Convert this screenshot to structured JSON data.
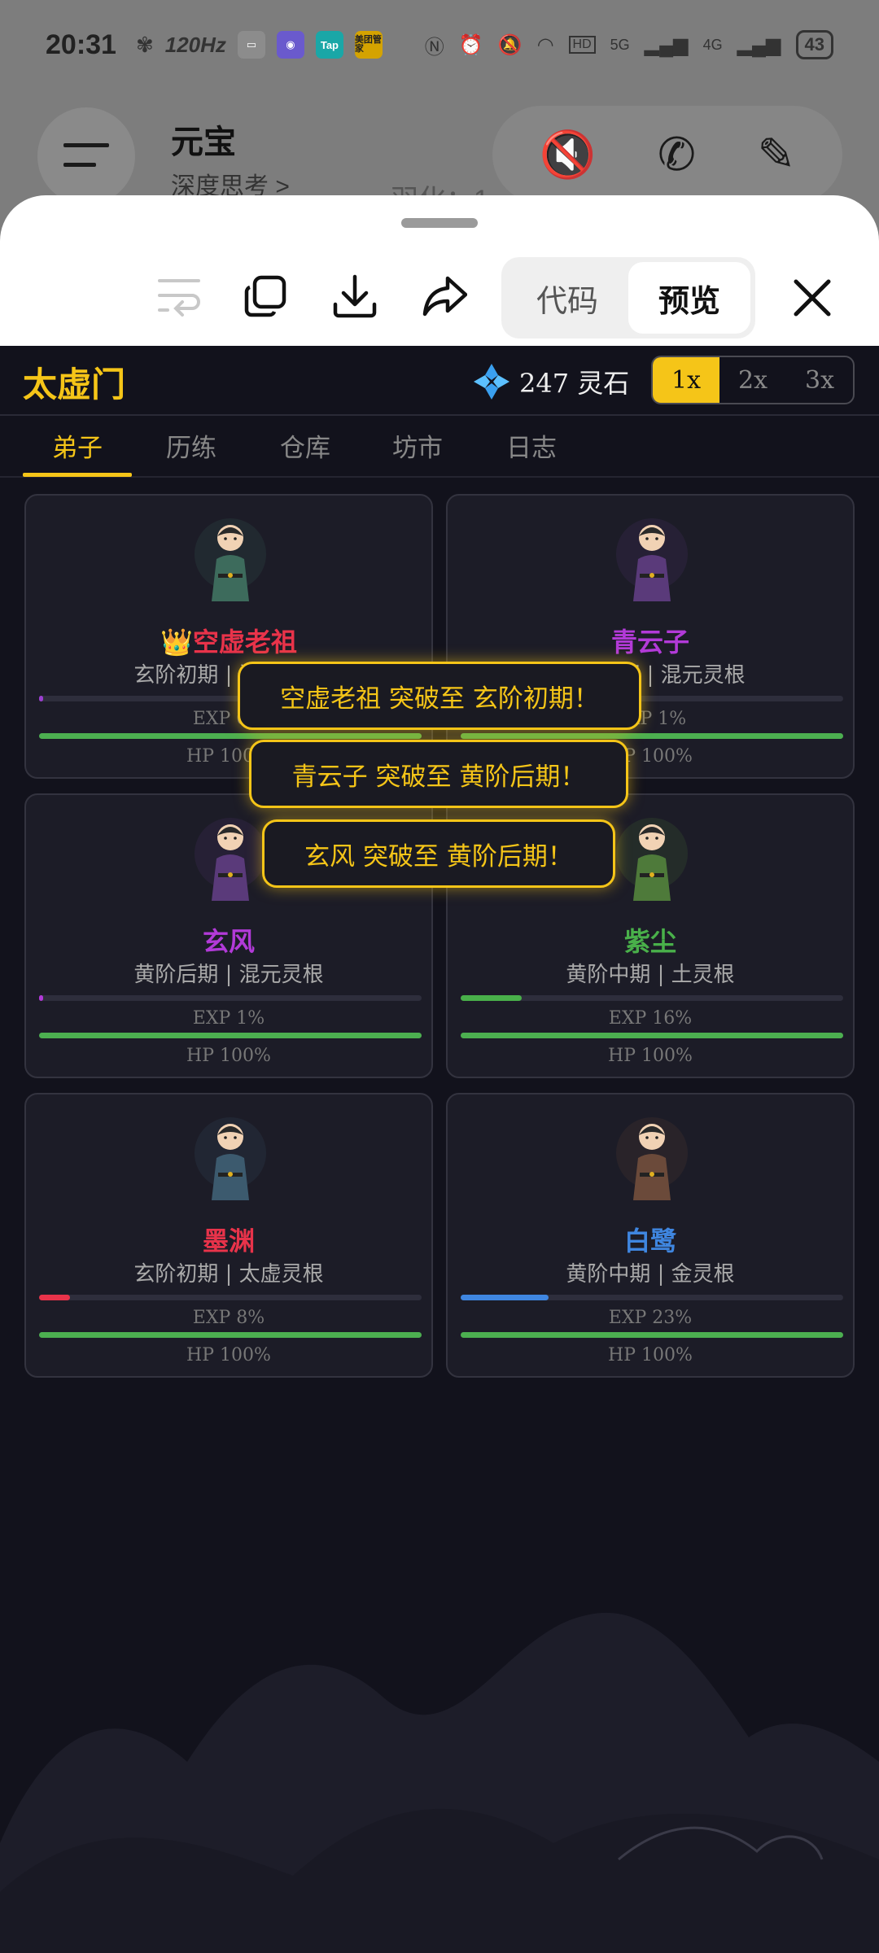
{
  "status_bar": {
    "time": "20:31",
    "refresh_rate": "120Hz",
    "app_badges": [
      "Tap",
      "美团管家"
    ],
    "network": [
      "5G",
      "4G"
    ],
    "battery": "43"
  },
  "background_chat": {
    "title": "元宝",
    "subtitle": "深度思考 >",
    "ghost_text": "羽化：1"
  },
  "preview_sheet": {
    "toolbar": {
      "icons": [
        "wrap-icon",
        "copy-icon",
        "download-icon",
        "share-icon",
        "close-icon"
      ],
      "tabs": [
        {
          "label": "代码",
          "active": false
        },
        {
          "label": "预览",
          "active": true
        }
      ]
    }
  },
  "game": {
    "title": "太虚门",
    "currency": {
      "amount_label": "247 灵石"
    },
    "speed_buttons": [
      {
        "label": "1x",
        "active": true
      },
      {
        "label": "2x",
        "active": false
      },
      {
        "label": "3x",
        "active": false
      }
    ],
    "tabs": [
      "弟子",
      "历练",
      "仓库",
      "坊市",
      "日志"
    ],
    "active_tab": "弟子",
    "toasts": [
      "空虚老祖 突破至 玄阶初期！",
      "青云子 突破至 黄阶后期！",
      "玄风 突破至 黄阶后期！"
    ],
    "disciples": [
      {
        "name": "👑空虚老祖",
        "info": "玄阶初期 | 混元灵根",
        "exp_label": "EXP 0%",
        "hp_label": "HP 100%",
        "exp": 0,
        "hp": 100,
        "name_color": "#e8334a",
        "exp_color": "#9b3fd0",
        "robe_color": "#3d6b5c"
      },
      {
        "name": "青云子",
        "info": "黄阶后期 | 混元灵根",
        "exp_label": "EXP 1%",
        "hp_label": "HP 100%",
        "exp": 1,
        "hp": 100,
        "name_color": "#b23ad8",
        "exp_color": "#b23ad8",
        "robe_color": "#5a3a7a"
      },
      {
        "name": "玄风",
        "info": "黄阶后期 | 混元灵根",
        "exp_label": "EXP 1%",
        "hp_label": "HP 100%",
        "exp": 1,
        "hp": 100,
        "name_color": "#b23ad8",
        "exp_color": "#b23ad8",
        "robe_color": "#5a3a7a"
      },
      {
        "name": "紫尘",
        "info": "黄阶中期 | 土灵根",
        "exp_label": "EXP 16%",
        "hp_label": "HP 100%",
        "exp": 16,
        "hp": 100,
        "name_color": "#49b04a",
        "exp_color": "#49b04a",
        "robe_color": "#4e7a3a"
      },
      {
        "name": "墨渊",
        "info": "玄阶初期 | 太虚灵根",
        "exp_label": "EXP 8%",
        "hp_label": "HP 100%",
        "exp": 8,
        "hp": 100,
        "name_color": "#e8334a",
        "exp_color": "#e8334a",
        "robe_color": "#3c5a6e"
      },
      {
        "name": "白鹭",
        "info": "黄阶中期 | 金灵根",
        "exp_label": "EXP 23%",
        "hp_label": "HP 100%",
        "exp": 23,
        "hp": 100,
        "name_color": "#3f86e0",
        "exp_color": "#3f86e0",
        "robe_color": "#6b4a3a"
      }
    ],
    "colors": {
      "accent": "#f5c518",
      "hp": "#4caf50",
      "background": "#12121c"
    }
  }
}
